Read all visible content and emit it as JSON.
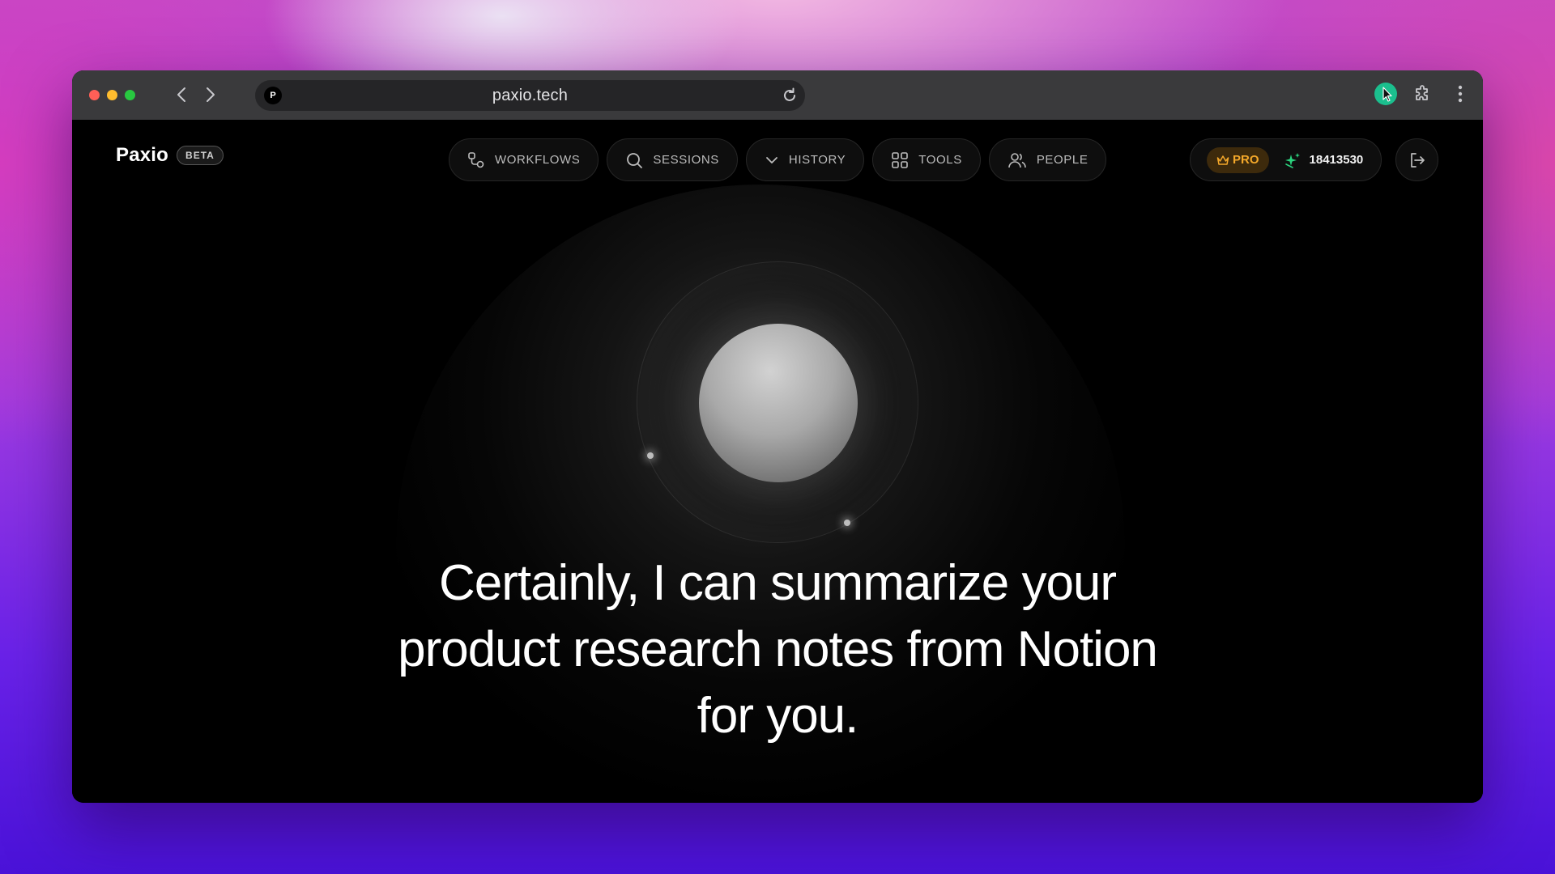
{
  "browser": {
    "favicon_letter": "P",
    "url": "paxio.tech",
    "traffic_light_colors": [
      "#ff5f57",
      "#febc2e",
      "#28c840"
    ]
  },
  "app": {
    "brand": "Paxio",
    "badge": "BETA",
    "nav": [
      {
        "label": "WORKFLOWS",
        "icon": "workflow-icon"
      },
      {
        "label": "SESSIONS",
        "icon": "search-icon"
      },
      {
        "label": "HISTORY",
        "icon": "chevron-down-icon"
      },
      {
        "label": "TOOLS",
        "icon": "grid-icon"
      },
      {
        "label": "PEOPLE",
        "icon": "people-icon"
      }
    ],
    "account": {
      "plan": "PRO",
      "credits": "18413530"
    },
    "message": "Certainly, I can summarize your product research notes from Notion for you."
  },
  "colors": {
    "pro_accent": "#f4a82a",
    "credits_icon": "#2bd47e"
  }
}
